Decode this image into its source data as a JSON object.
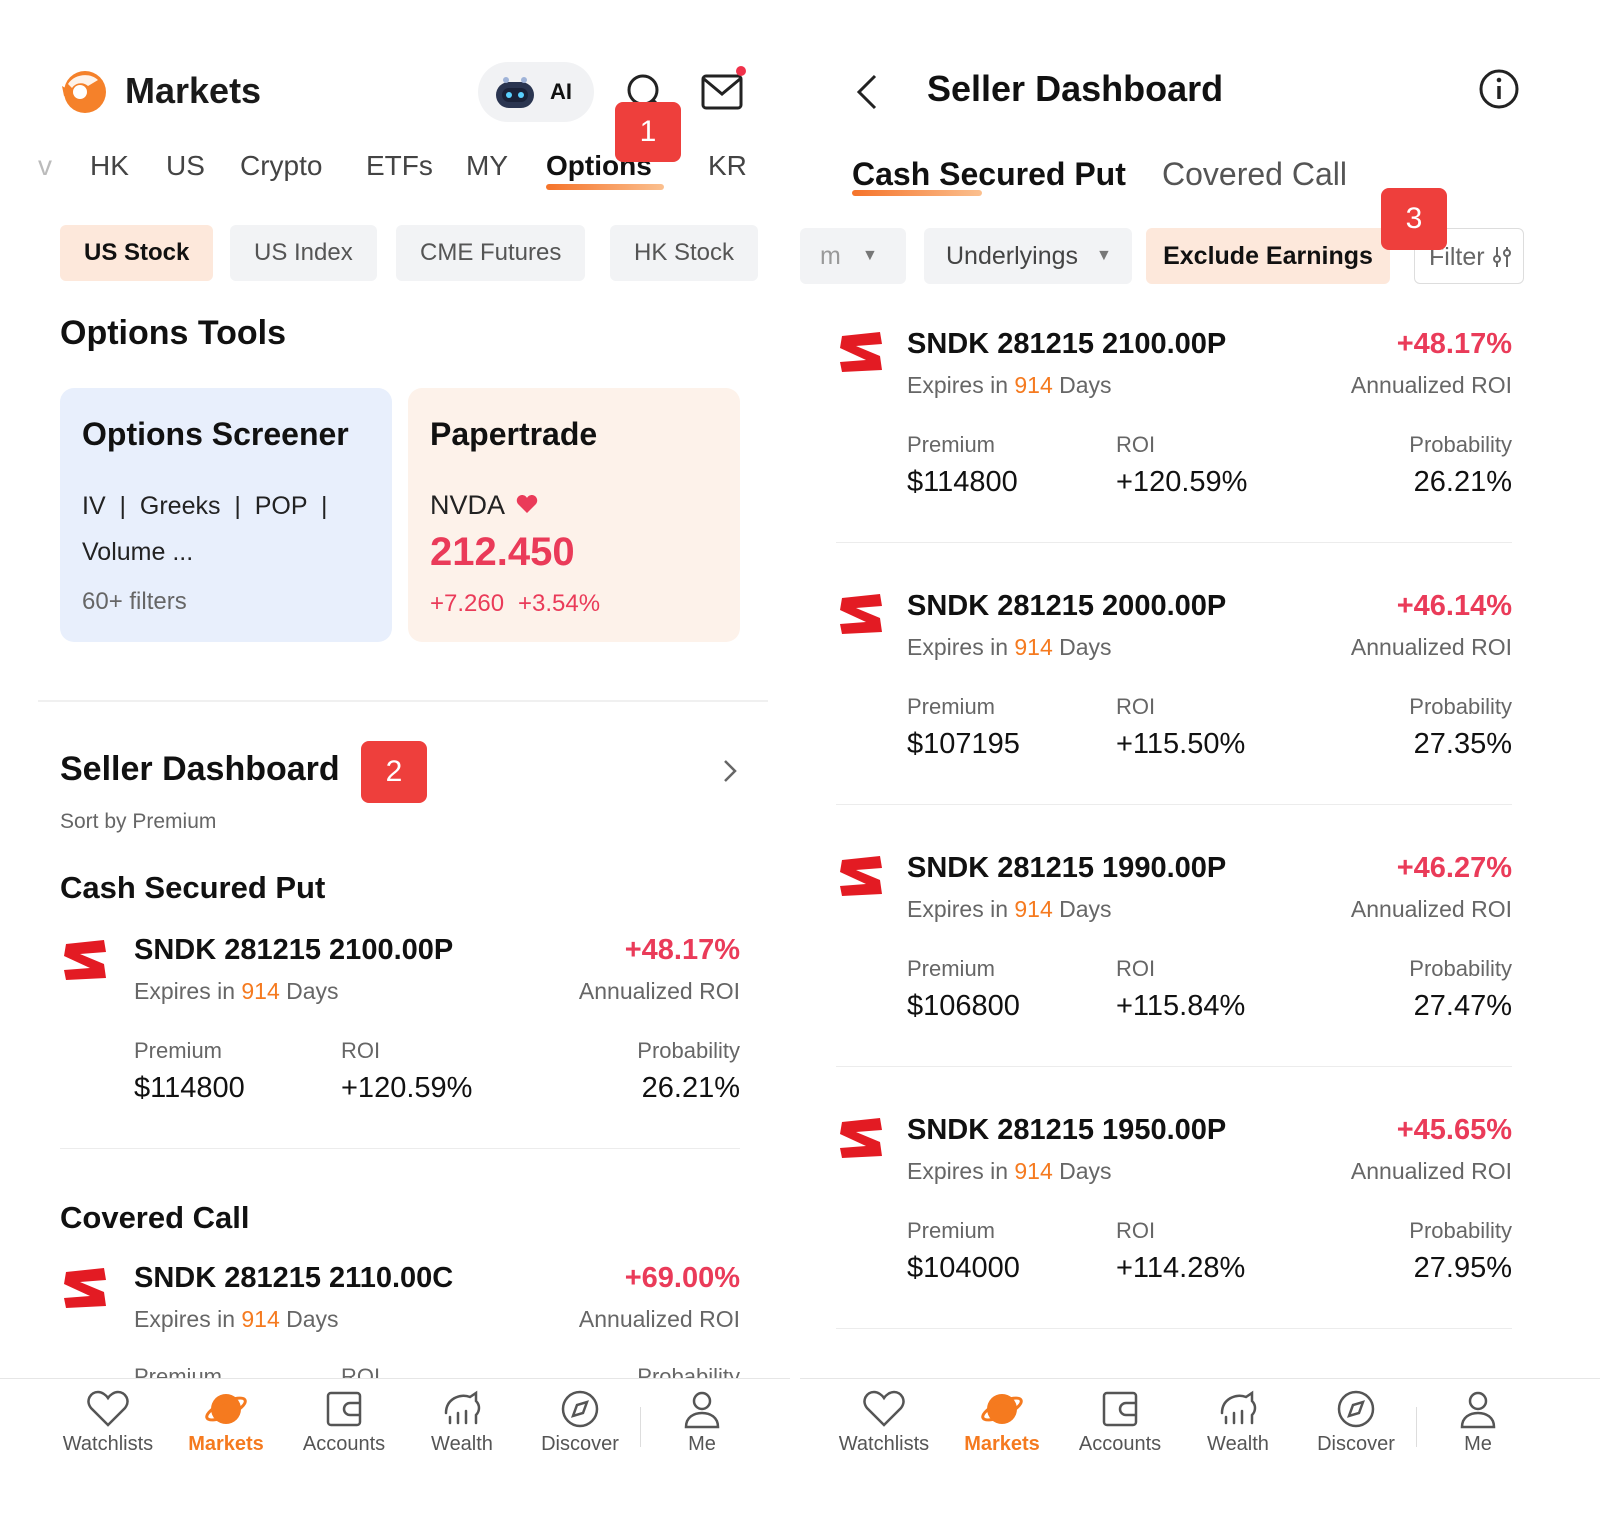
{
  "left": {
    "header": {
      "title": "Markets",
      "ai_label": "AI",
      "badge": "1"
    },
    "tabs": [
      "v",
      "HK",
      "US",
      "Crypto",
      "ETFs",
      "MY",
      "Options",
      "KR"
    ],
    "chips": [
      "US Stock",
      "US Index",
      "CME Futures",
      "HK Stock"
    ],
    "options_tools": {
      "title": "Options Tools",
      "screener": {
        "title": "Options Screener",
        "tags": "IV  |  Greeks  |  POP  |",
        "tags2": "Volume ...",
        "filters": "60+ filters"
      },
      "papertrade": {
        "title": "Papertrade",
        "symbol": "NVDA",
        "price": "212.450",
        "change": "+7.260",
        "change_pct": "+3.54%"
      }
    },
    "seller_dashboard": {
      "title": "Seller Dashboard",
      "badge": "2",
      "sort": "Sort by Premium",
      "csp_title": "Cash Secured Put",
      "csp_row": {
        "ticker": "SNDK 281215 2100.00P",
        "expires_prefix": "Expires in ",
        "days": "914",
        "expires_suffix": " Days",
        "pct": "+48.17%",
        "pct_label": "Annualized ROI",
        "premium_label": "Premium",
        "premium": "$114800",
        "roi_label": "ROI",
        "roi": "+120.59%",
        "prob_label": "Probability",
        "prob": "26.21%"
      },
      "cc_title": "Covered Call",
      "cc_row": {
        "ticker": "SNDK 281215 2110.00C",
        "expires_prefix": "Expires in ",
        "days": "914",
        "expires_suffix": " Days",
        "pct": "+69.00%",
        "pct_label": "Annualized ROI",
        "premium_label": "Premium",
        "roi_label": "ROI",
        "prob_label": "Probability"
      }
    }
  },
  "right": {
    "header": {
      "title": "Seller Dashboard"
    },
    "tabs": [
      "Cash Secured Put",
      "Covered Call"
    ],
    "filters": {
      "partial": "m",
      "underlyings": "Underlyings",
      "exclude": "Exclude Earnings",
      "filter": "Filter",
      "badge": "3"
    },
    "rows": [
      {
        "ticker": "SNDK 281215 2100.00P",
        "days": "914",
        "pct": "+48.17%",
        "premium": "$114800",
        "roi": "+120.59%",
        "prob": "26.21%"
      },
      {
        "ticker": "SNDK 281215 2000.00P",
        "days": "914",
        "pct": "+46.14%",
        "premium": "$107195",
        "roi": "+115.50%",
        "prob": "27.35%"
      },
      {
        "ticker": "SNDK 281215 1990.00P",
        "days": "914",
        "pct": "+46.27%",
        "premium": "$106800",
        "roi": "+115.84%",
        "prob": "27.47%"
      },
      {
        "ticker": "SNDK 281215 1950.00P",
        "days": "914",
        "pct": "+45.65%",
        "premium": "$104000",
        "roi": "+114.28%",
        "prob": "27.95%"
      }
    ],
    "row_labels": {
      "expires_prefix": "Expires in ",
      "expires_suffix": " Days",
      "pct_label": "Annualized ROI",
      "premium_label": "Premium",
      "roi_label": "ROI",
      "prob_label": "Probability"
    }
  },
  "nav": [
    "Watchlists",
    "Markets",
    "Accounts",
    "Wealth",
    "Discover",
    "Me"
  ],
  "colors": {
    "accent": "#f57a1f",
    "positive": "#ea3b59",
    "badge": "#ee3f3c",
    "screener_bg": "#e8effc",
    "papertrade_bg": "#fdf2ea"
  }
}
